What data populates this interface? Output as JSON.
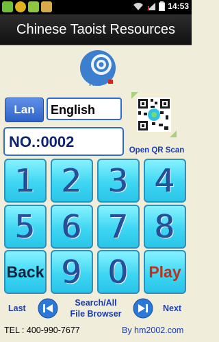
{
  "status": {
    "time": "14:53"
  },
  "app": {
    "title": "Chinese Taoist Resources"
  },
  "logo_text": "HM",
  "language": {
    "button_label": "Lan",
    "value": "English"
  },
  "number_field": {
    "value": "NO.:0002"
  },
  "qr": {
    "label": "Open QR Scan"
  },
  "keypad": {
    "k1": "1",
    "k2": "2",
    "k3": "3",
    "k4": "4",
    "k5": "5",
    "k6": "6",
    "k7": "7",
    "k8": "8",
    "back": "Back",
    "k9": "9",
    "k0": "0",
    "play": "Play"
  },
  "nav": {
    "last": "Last",
    "search_line1": "Search/All",
    "search_line2": "File Browser",
    "next": "Next"
  },
  "footer": {
    "tel": "TEL : 400-990-7677",
    "by": "By hm2002.com"
  },
  "colors": {
    "key": "#3fd6f3",
    "accent": "#1a3db0",
    "play": "#b83320"
  }
}
